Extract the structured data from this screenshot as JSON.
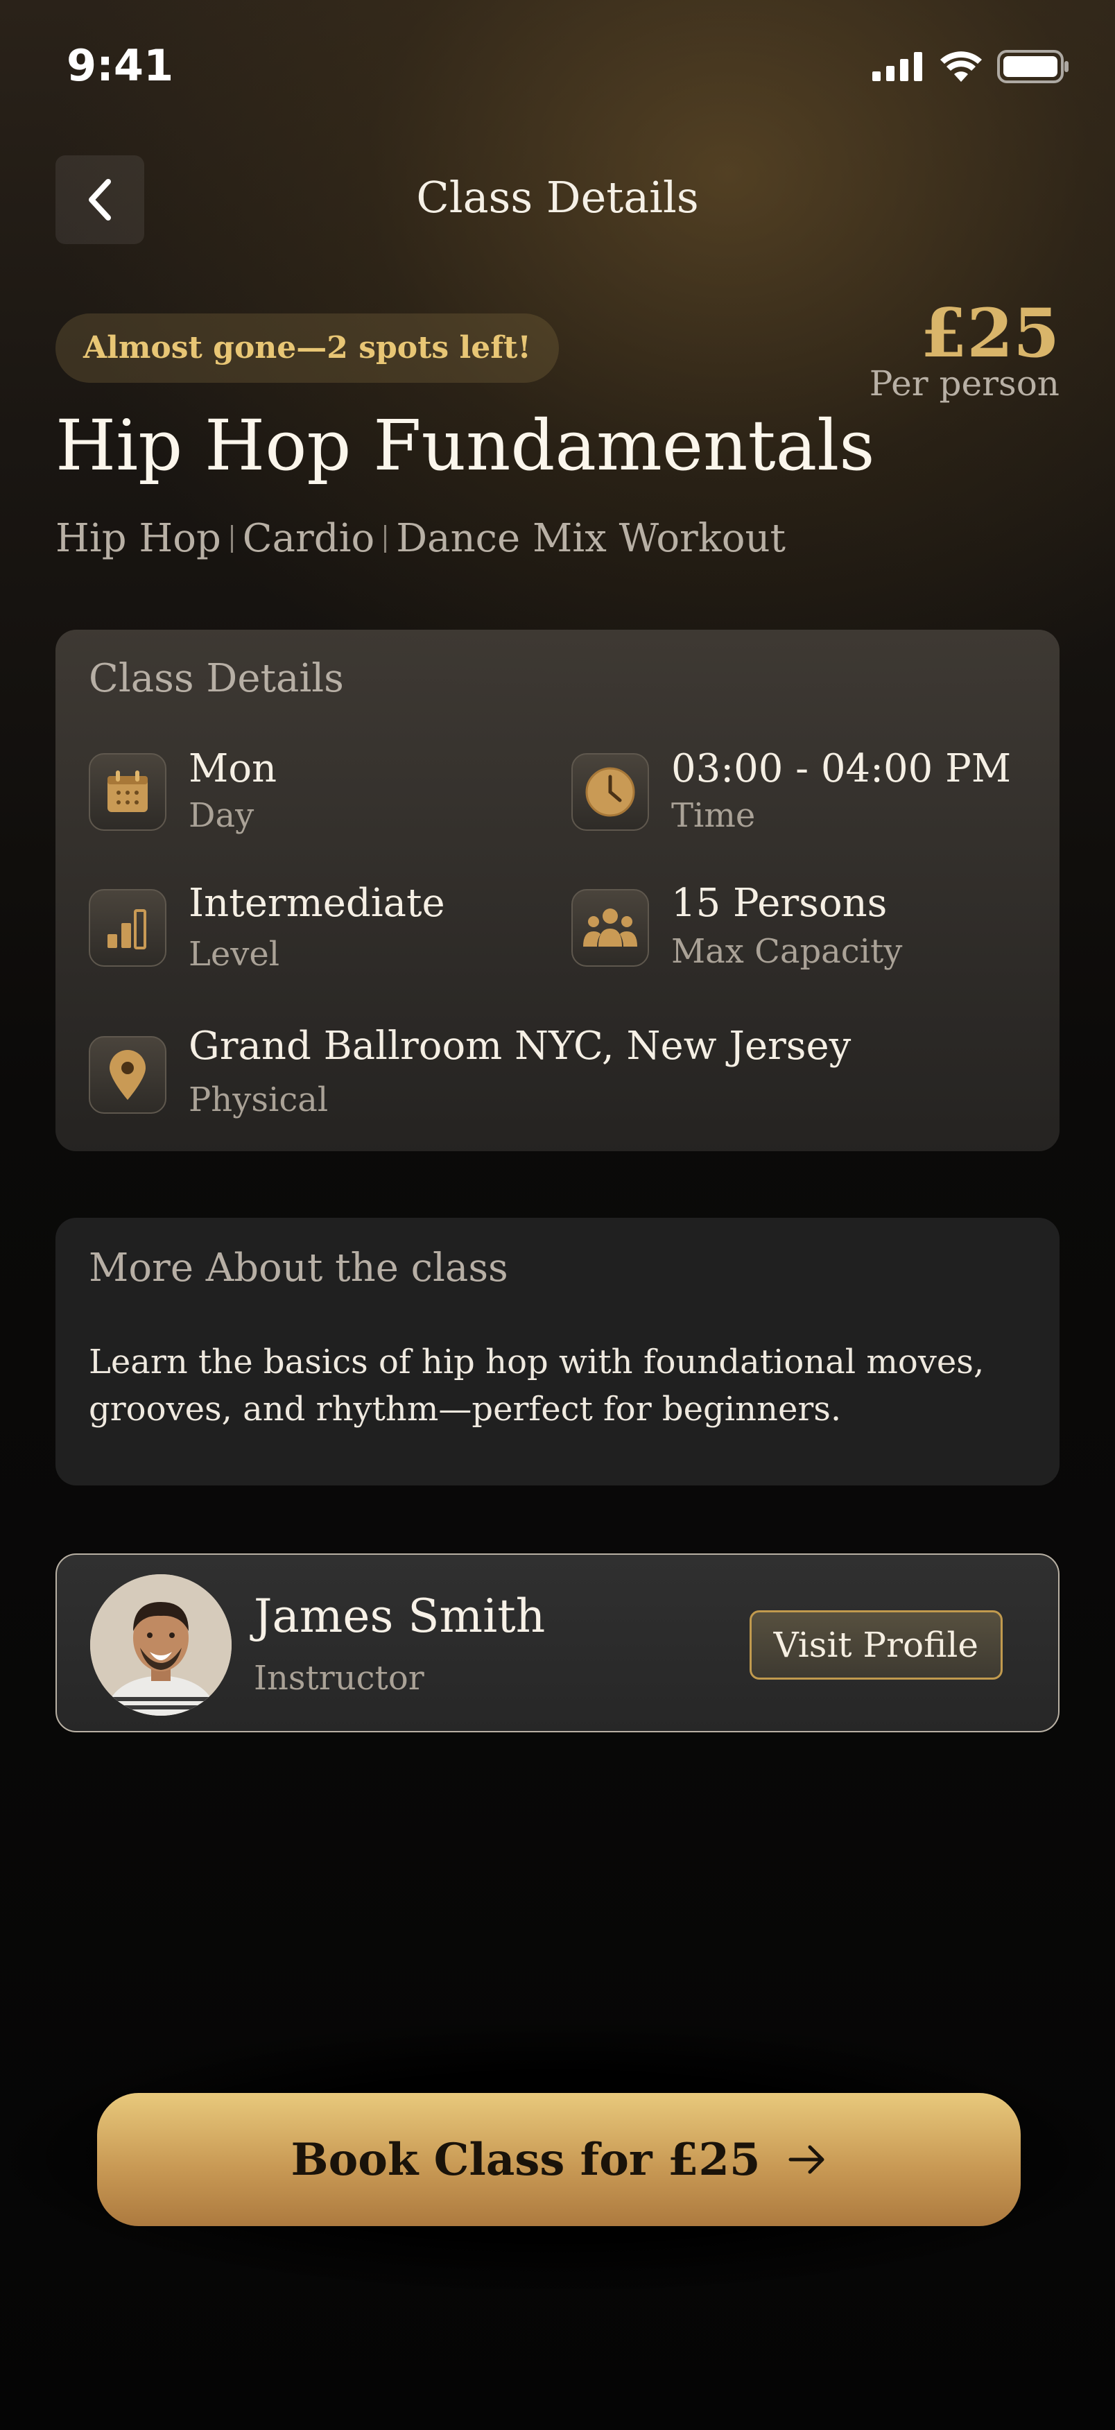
{
  "status_bar": {
    "time": "9:41"
  },
  "header": {
    "title": "Class Details"
  },
  "hero": {
    "badge": "Almost gone—2 spots left!",
    "price": "£25",
    "price_sub": "Per person",
    "title": "Hip Hop Fundamentals",
    "tags": [
      "Hip Hop",
      "Cardio",
      "Dance Mix Workout"
    ]
  },
  "details_card": {
    "heading": "Class Details",
    "items": [
      {
        "icon": "calendar-icon",
        "value": "Mon",
        "label": "Day"
      },
      {
        "icon": "clock-icon",
        "value": "03:00 - 04:00 PM",
        "label": "Time"
      },
      {
        "icon": "bar-chart-icon",
        "value": "Intermediate",
        "label": "Level"
      },
      {
        "icon": "group-icon",
        "value": "15 Persons",
        "label": "Max Capacity"
      },
      {
        "icon": "location-pin-icon",
        "value": "Grand Ballroom NYC, New Jersey",
        "label": "Physical"
      }
    ]
  },
  "about_card": {
    "heading": "More About the class",
    "text": "Learn the basics of hip hop with foundational moves, grooves, and rhythm—perfect for beginners."
  },
  "instructor": {
    "name": "James Smith",
    "role": "Instructor",
    "button": "Visit Profile"
  },
  "book_button": {
    "label": "Book Class for £25"
  },
  "colors": {
    "accent_gold": "#d9b56a",
    "background": "#050505"
  }
}
